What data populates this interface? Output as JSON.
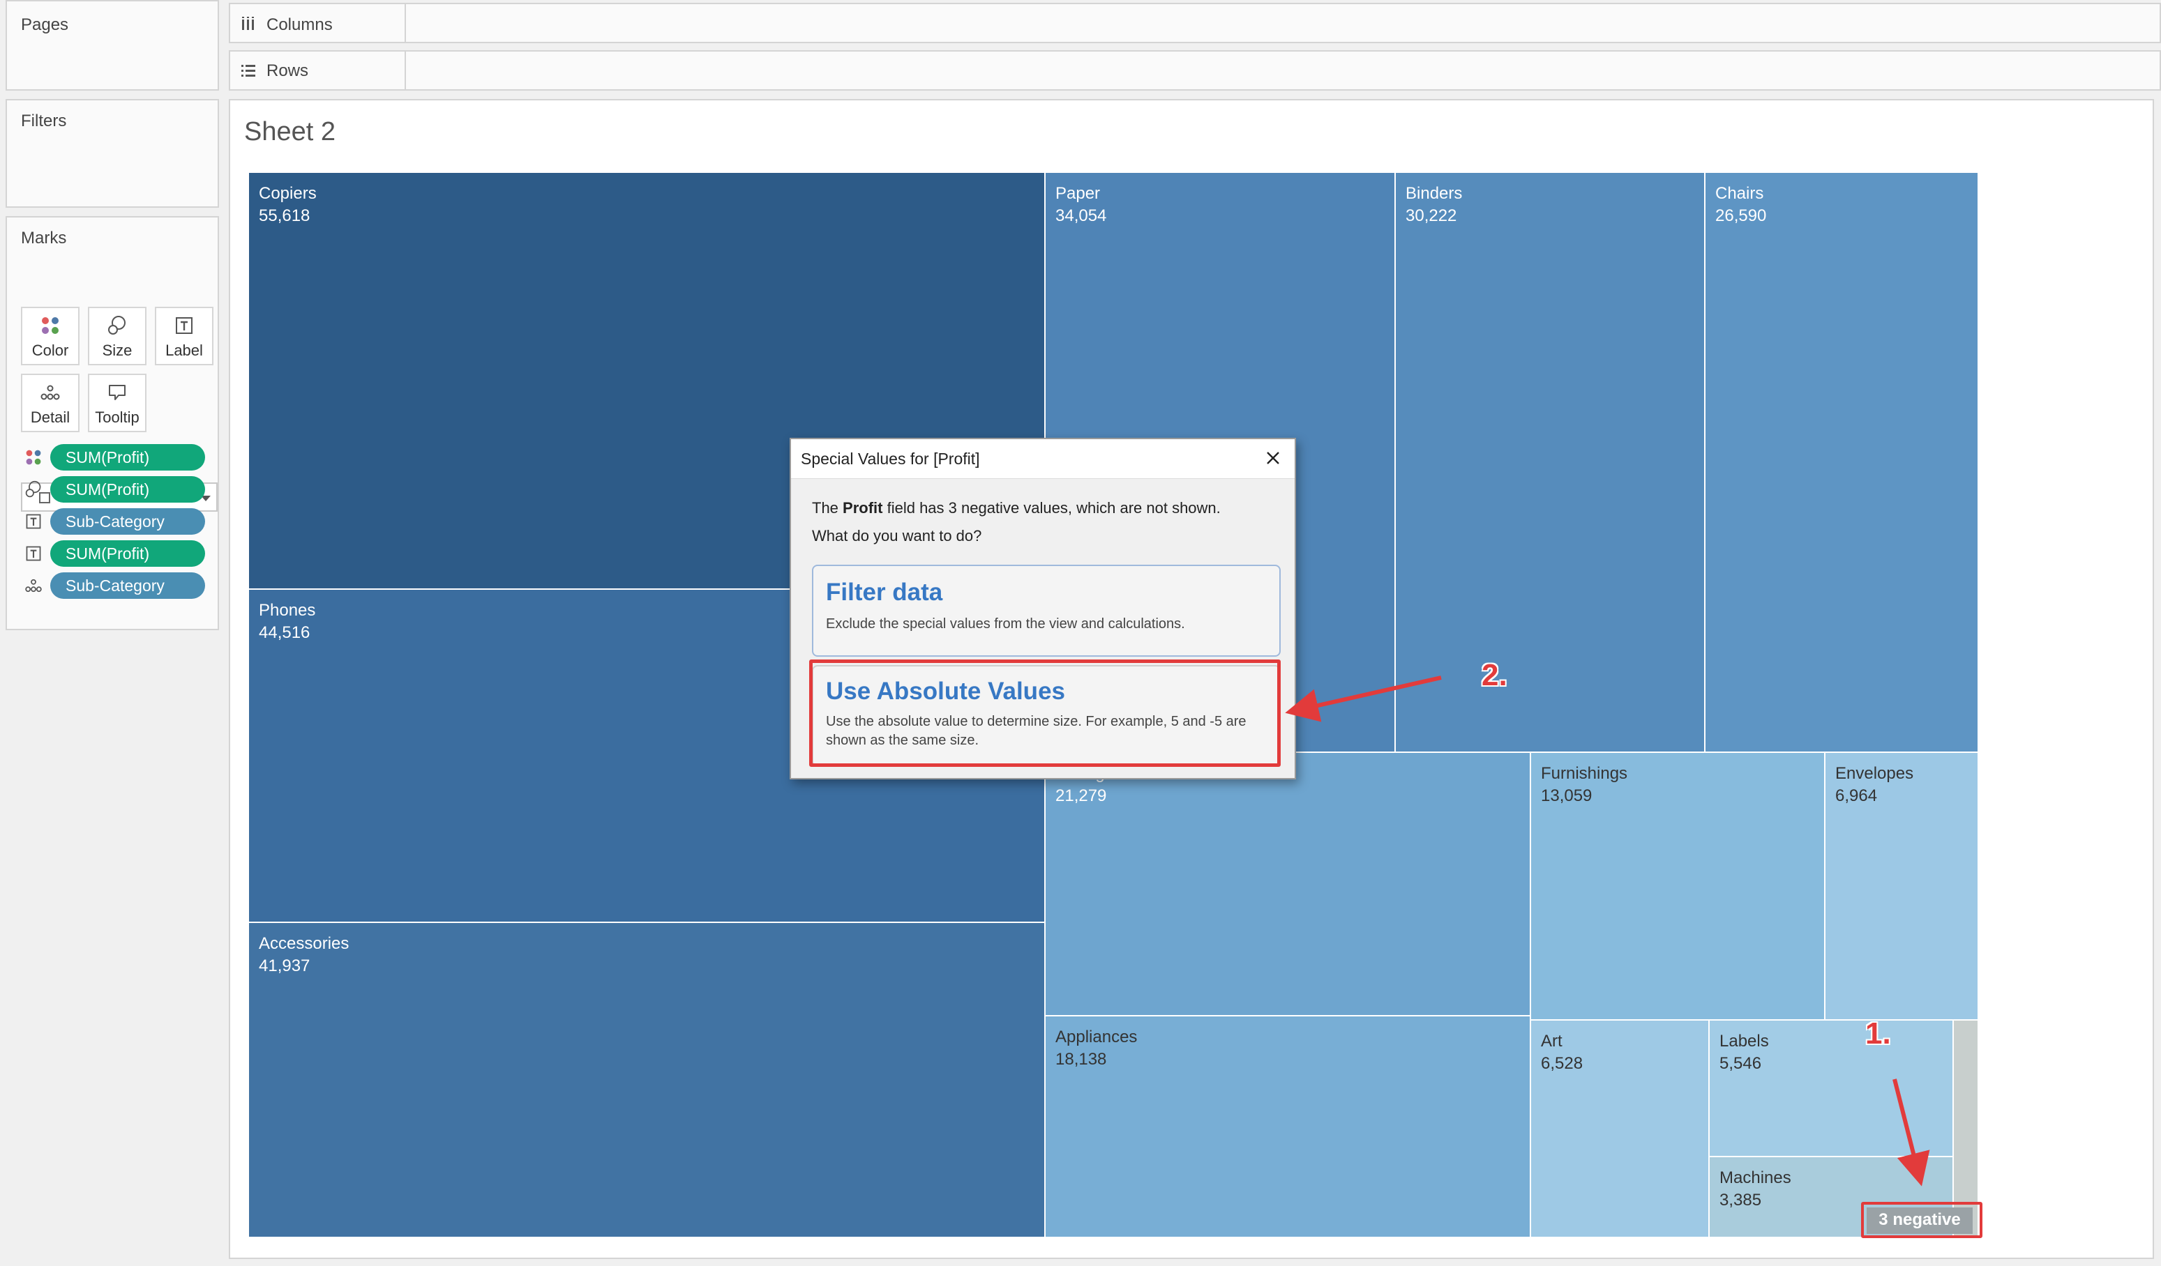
{
  "left_panels": {
    "pages_label": "Pages",
    "filters_label": "Filters",
    "marks_label": "Marks",
    "mark_type": "Automatic",
    "mark_buttons": [
      "Color",
      "Size",
      "Label",
      "Detail",
      "Tooltip"
    ],
    "mark_fields": [
      {
        "icon": "color-icon",
        "label": "SUM(Profit)",
        "color": "#11a77a"
      },
      {
        "icon": "size-icon",
        "label": "SUM(Profit)",
        "color": "#11a77a"
      },
      {
        "icon": "label-icon",
        "label": "Sub-Category",
        "color": "#4a8eb3"
      },
      {
        "icon": "label-icon",
        "label": "SUM(Profit)",
        "color": "#11a77a"
      },
      {
        "icon": "detail-icon",
        "label": "Sub-Category",
        "color": "#4a8eb3"
      }
    ]
  },
  "shelves": {
    "columns_label": "Columns",
    "rows_label": "Rows"
  },
  "sheet": {
    "title": "Sheet 2",
    "tiles": [
      {
        "name": "Copiers",
        "value": "55,618",
        "color": "#2d5b88"
      },
      {
        "name": "Paper",
        "value": "34,054",
        "color": "#4f84b6"
      },
      {
        "name": "Binders",
        "value": "30,222",
        "color": "#568cbc"
      },
      {
        "name": "Chairs",
        "value": "26,590",
        "color": "#5e95c4"
      },
      {
        "name": "Phones",
        "value": "44,516",
        "color": "#3b6d9f"
      },
      {
        "name": "Accessories",
        "value": "41,937",
        "color": "#4173a3"
      },
      {
        "name": "Storage",
        "value": "21,279",
        "color": "#6ea5cf"
      },
      {
        "name": "Furnishings",
        "value": "13,059",
        "color": "#87bbdd"
      },
      {
        "name": "Envelopes",
        "value": "6,964",
        "color": "#9cc8e5"
      },
      {
        "name": "Appliances",
        "value": "18,138",
        "color": "#78aed5"
      },
      {
        "name": "Art",
        "value": "6,528",
        "color": "#9ec9e5"
      },
      {
        "name": "Labels",
        "value": "5,546",
        "color": "#a2cce6"
      },
      {
        "name": "Machines",
        "value": "3,385",
        "color": "#a9ccdc"
      }
    ],
    "negative_indicator": "3 negative"
  },
  "dialog": {
    "title": "Special Values for [Profit]",
    "message_prefix": "The ",
    "message_field": "Profit",
    "message_suffix": " field has 3 negative values, which are not shown.",
    "question": "What do you want to do?",
    "option_filter": {
      "title": "Filter data",
      "description": "Exclude the special values from the view and calculations."
    },
    "option_absolute": {
      "title": "Use Absolute Values",
      "description": "Use the absolute value to determine size. For example, 5 and -5 are shown as the same size."
    }
  },
  "annotations": {
    "step1": "1.",
    "step2": "2.",
    "color": "#e23b3b"
  }
}
